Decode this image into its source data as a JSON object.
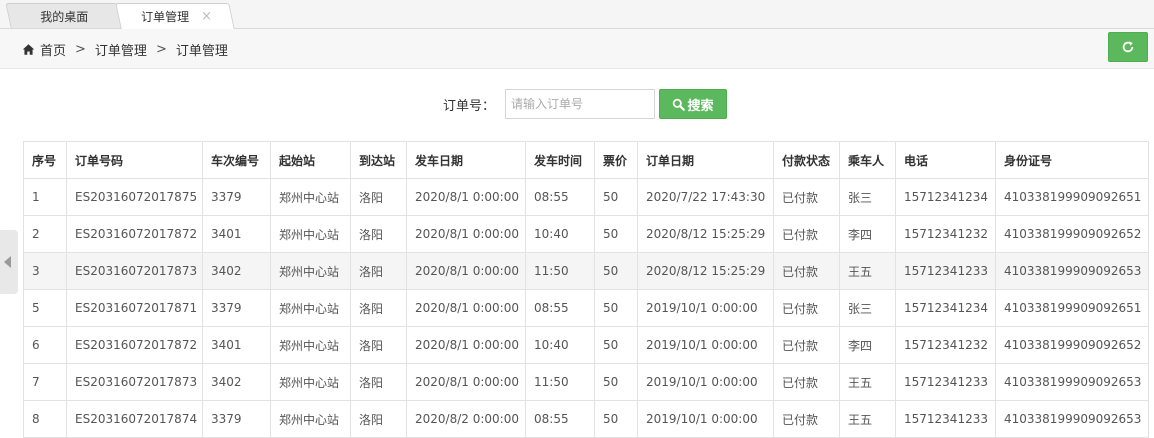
{
  "tabs": [
    {
      "label": "我的桌面",
      "active": false
    },
    {
      "label": "订单管理",
      "active": true,
      "close": "×"
    }
  ],
  "breadcrumb": {
    "items": [
      "首页",
      "订单管理",
      "订单管理"
    ],
    "separator": ">"
  },
  "search": {
    "label": "订单号：",
    "placeholder": "请输入订单号",
    "button_label": "搜索"
  },
  "colors": {
    "accent_green": "#5cb85c"
  },
  "icons": {
    "home": "home-icon",
    "refresh": "refresh-icon",
    "search": "search-icon",
    "collapse": "chevron-left-icon"
  },
  "table": {
    "headers": [
      "序号",
      "订单号码",
      "车次编号",
      "起始站",
      "到达站",
      "发车日期",
      "发车时间",
      "票价",
      "订单日期",
      "付款状态",
      "乘车人",
      "电话",
      "身份证号"
    ],
    "rows": [
      [
        "1",
        "ES20316072017875",
        "3379",
        "郑州中心站",
        "洛阳",
        "2020/8/1 0:00:00",
        "08:55",
        "50",
        "2020/7/22 17:43:30",
        "已付款",
        "张三",
        "15712341234",
        "410338199909092651"
      ],
      [
        "2",
        "ES20316072017872",
        "3401",
        "郑州中心站",
        "洛阳",
        "2020/8/1 0:00:00",
        "10:40",
        "50",
        "2020/8/12 15:25:29",
        "已付款",
        "李四",
        "15712341232",
        "410338199909092652"
      ],
      [
        "3",
        "ES20316072017873",
        "3402",
        "郑州中心站",
        "洛阳",
        "2020/8/1 0:00:00",
        "11:50",
        "50",
        "2020/8/12 15:25:29",
        "已付款",
        "王五",
        "15712341233",
        "410338199909092653"
      ],
      [
        "5",
        "ES20316072017871",
        "3379",
        "郑州中心站",
        "洛阳",
        "2020/8/1 0:00:00",
        "08:55",
        "50",
        "2019/10/1 0:00:00",
        "已付款",
        "张三",
        "15712341234",
        "410338199909092651"
      ],
      [
        "6",
        "ES20316072017872",
        "3401",
        "郑州中心站",
        "洛阳",
        "2020/8/1 0:00:00",
        "10:40",
        "50",
        "2019/10/1 0:00:00",
        "已付款",
        "李四",
        "15712341232",
        "410338199909092652"
      ],
      [
        "7",
        "ES20316072017873",
        "3402",
        "郑州中心站",
        "洛阳",
        "2020/8/1 0:00:00",
        "11:50",
        "50",
        "2019/10/1 0:00:00",
        "已付款",
        "王五",
        "15712341233",
        "410338199909092653"
      ],
      [
        "8",
        "ES20316072017874",
        "3379",
        "郑州中心站",
        "洛阳",
        "2020/8/2 0:00:00",
        "08:55",
        "50",
        "2019/10/1 0:00:00",
        "已付款",
        "王五",
        "15712341233",
        "410338199909092653"
      ]
    ]
  }
}
